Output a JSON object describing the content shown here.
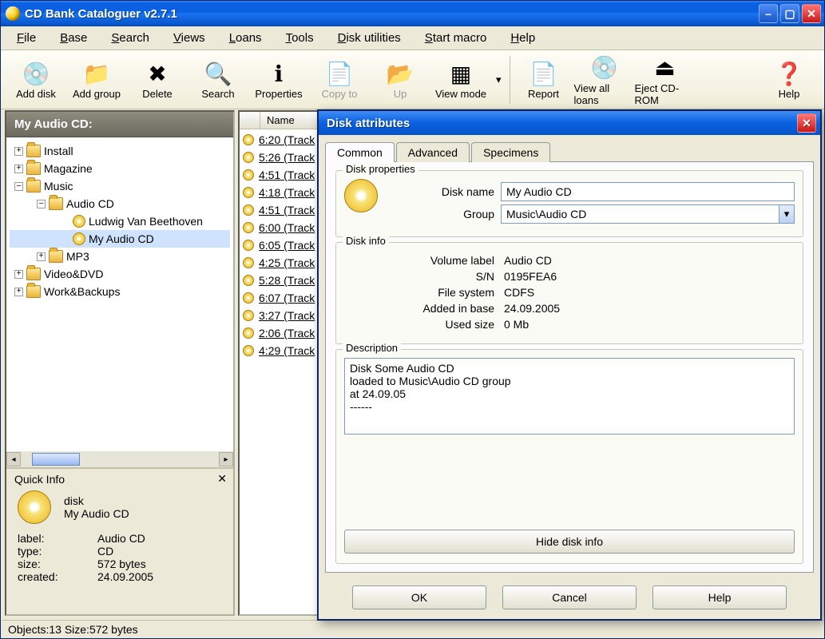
{
  "window": {
    "title": "CD Bank Cataloguer v2.7.1"
  },
  "menu": [
    "File",
    "Base",
    "Search",
    "Views",
    "Loans",
    "Tools",
    "Disk utilities",
    "Start macro",
    "Help"
  ],
  "toolbar": [
    {
      "name": "add-disk",
      "label": "Add disk",
      "icon": "💿"
    },
    {
      "name": "add-group",
      "label": "Add group",
      "icon": "📁"
    },
    {
      "name": "delete",
      "label": "Delete",
      "icon": "✖"
    },
    {
      "name": "search",
      "label": "Search",
      "icon": "🔍"
    },
    {
      "name": "properties",
      "label": "Properties",
      "icon": "ℹ"
    },
    {
      "name": "copy-to",
      "label": "Copy to",
      "icon": "📄",
      "disabled": true
    },
    {
      "name": "up",
      "label": "Up",
      "icon": "📂",
      "disabled": true
    },
    {
      "name": "view-mode",
      "label": "View mode",
      "icon": "▦"
    },
    {
      "name": "report",
      "label": "Report",
      "icon": "📄"
    },
    {
      "name": "view-loans",
      "label": "View all loans",
      "icon": "💿"
    },
    {
      "name": "eject",
      "label": "Eject CD-ROM",
      "icon": "⏏"
    },
    {
      "name": "help",
      "label": "Help",
      "icon": "❓"
    }
  ],
  "sidebar": {
    "header": "My Audio CD:",
    "tree": [
      {
        "label": "Install",
        "exp": "+",
        "depth": 0,
        "ic": "folder"
      },
      {
        "label": "Magazine",
        "exp": "+",
        "depth": 0,
        "ic": "folder"
      },
      {
        "label": "Music",
        "exp": "–",
        "depth": 0,
        "ic": "folder"
      },
      {
        "label": "Audio CD",
        "exp": "–",
        "depth": 1,
        "ic": "folder"
      },
      {
        "label": "Ludwig Van Beethoven",
        "exp": "",
        "depth": 2,
        "ic": "cd"
      },
      {
        "label": "My Audio CD",
        "exp": "",
        "depth": 2,
        "ic": "cd",
        "sel": true
      },
      {
        "label": "MP3",
        "exp": "+",
        "depth": 1,
        "ic": "folder"
      },
      {
        "label": "Video&DVD",
        "exp": "+",
        "depth": 0,
        "ic": "folder"
      },
      {
        "label": "Work&Backups",
        "exp": "+",
        "depth": 0,
        "ic": "folder"
      }
    ]
  },
  "quickinfo": {
    "title": "Quick Info",
    "disk_kind": "disk",
    "disk_name": "My Audio CD",
    "rows": [
      {
        "k": "label:",
        "v": "Audio CD"
      },
      {
        "k": "type:",
        "v": "CD"
      },
      {
        "k": "size:",
        "v": "572 bytes"
      },
      {
        "k": "created:",
        "v": "24.09.2005"
      }
    ]
  },
  "list": {
    "columns": [
      "",
      "Name"
    ],
    "rows": [
      "6:20 (Track",
      "5:26 (Track",
      "4:51 (Track",
      "4:18 (Track",
      "4:51 (Track",
      "6:00 (Track",
      "6:05 (Track",
      "4:25 (Track",
      "5:28 (Track",
      "6:07 (Track",
      "3:27 (Track",
      "2:06 (Track",
      "4:29 (Track"
    ]
  },
  "status": "Objects:13 Size:572 bytes",
  "dialog": {
    "title": "Disk attributes",
    "tabs": [
      "Common",
      "Advanced",
      "Specimens"
    ],
    "active_tab": 0,
    "props_label": "Disk properties",
    "disk_name_label": "Disk name",
    "disk_name_value": "My Audio CD",
    "group_label": "Group",
    "group_value": "Music\\Audio CD",
    "info_label": "Disk info",
    "info_rows": [
      {
        "k": "Volume label",
        "v": "Audio CD"
      },
      {
        "k": "S/N",
        "v": "0195FEA6"
      },
      {
        "k": "File system",
        "v": "CDFS"
      },
      {
        "k": "Added in base",
        "v": "24.09.2005"
      },
      {
        "k": "Used size",
        "v": "0 Mb"
      }
    ],
    "desc_label": "Description",
    "desc_value": "Disk Some Audio CD\nloaded to Music\\Audio CD group\nat 24.09.05\n------",
    "hide_btn": "Hide disk info",
    "ok": "OK",
    "cancel": "Cancel",
    "help": "Help"
  }
}
